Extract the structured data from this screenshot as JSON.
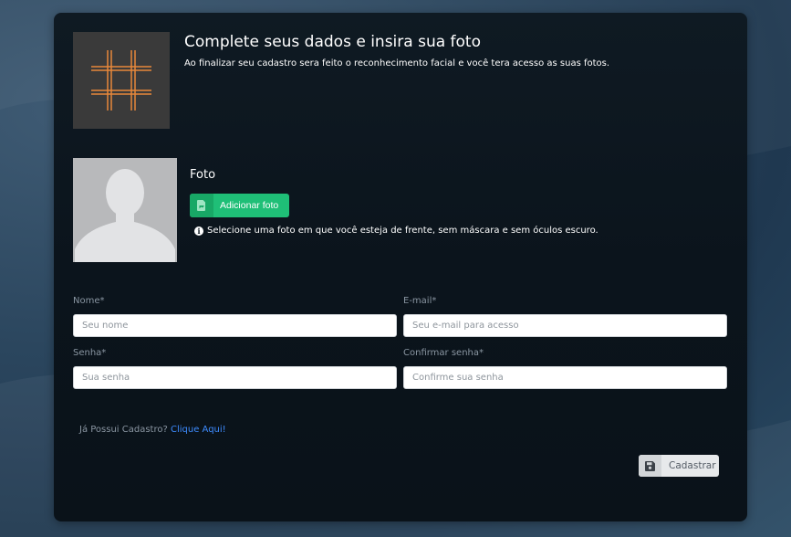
{
  "header": {
    "title": "Complete seus dados e insira sua foto",
    "subtitle": "Ao finalizar seu cadastro sera feito o reconhecimento facial e você tera acesso as suas fotos."
  },
  "photo": {
    "label": "Foto",
    "add_button": "Adicionar foto",
    "hint": "Selecione uma foto em que você esteja de frente, sem máscara e sem óculos escuro."
  },
  "form": {
    "name": {
      "label": "Nome*",
      "placeholder": "Seu nome",
      "value": ""
    },
    "email": {
      "label": "E-mail*",
      "placeholder": "Seu e-mail para acesso",
      "value": ""
    },
    "password": {
      "label": "Senha*",
      "placeholder": "Sua senha",
      "value": ""
    },
    "confirm_password": {
      "label": "Confirmar senha*",
      "placeholder": "Confirme sua senha",
      "value": ""
    }
  },
  "login": {
    "text": "Já Possui Cadastro?",
    "link": "Clique Aqui!"
  },
  "submit": {
    "label": "Cadastrar"
  },
  "colors": {
    "accent_green": "#1fbf77",
    "logo_orange": "#e8883a",
    "link_blue": "#3d8bfd"
  }
}
